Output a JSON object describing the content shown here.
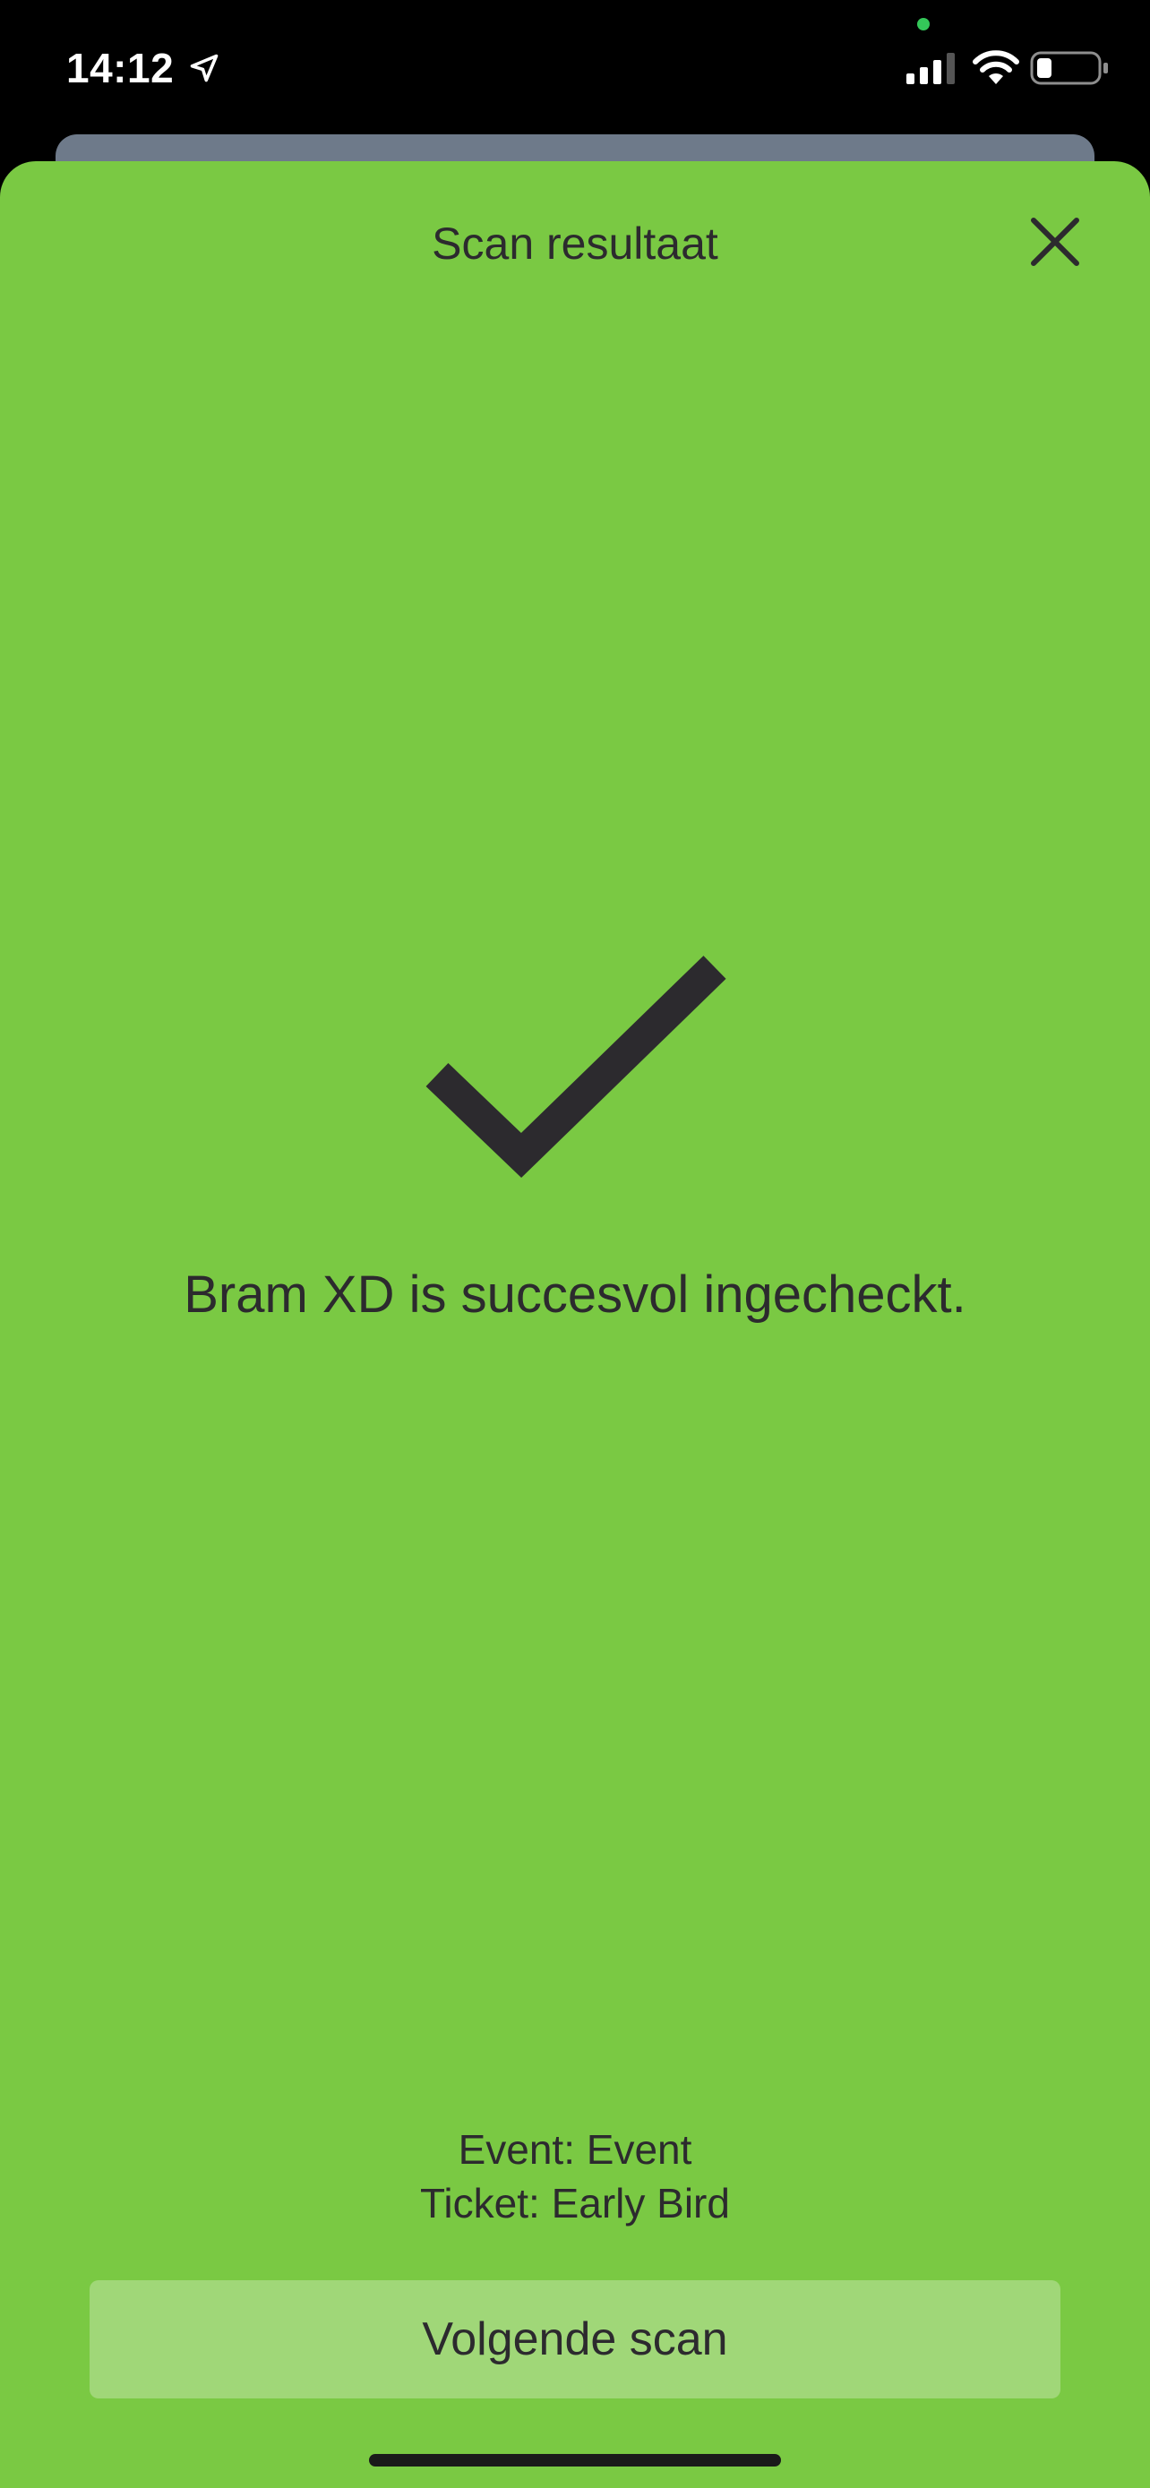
{
  "status_bar": {
    "time": "14:12",
    "location_icon": "location-arrow-icon",
    "signal_icon": "cellular-signal-icon",
    "wifi_icon": "wifi-icon",
    "battery_icon": "battery-low-icon",
    "camera_indicator_color": "#34c759"
  },
  "sheet": {
    "title": "Scan resultaat",
    "close_icon": "close-icon",
    "background_color": "#7ac943"
  },
  "result": {
    "status_icon": "checkmark-icon",
    "message": "Bram XD is succesvol ingecheckt."
  },
  "details": {
    "event": "Event: Event",
    "ticket": "Ticket: Early Bird"
  },
  "actions": {
    "next_scan_label": "Volgende scan"
  },
  "colors": {
    "accent": "#7ac943",
    "button": "#a0d778",
    "text": "#2c2a2e"
  }
}
